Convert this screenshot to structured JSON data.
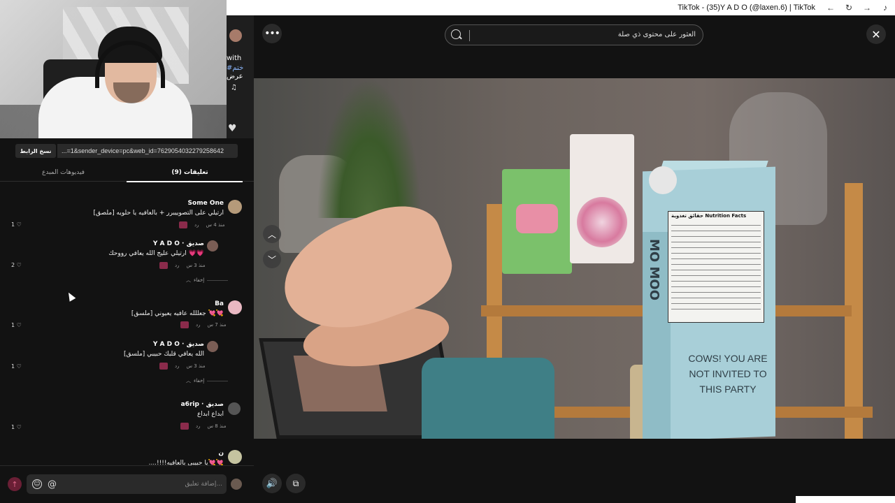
{
  "window": {
    "title": "TikTok - (35)Y A D O (@laxen.6) | TikTok"
  },
  "side_strip": {
    "text1": "with",
    "text2": "#ختم",
    "text3": "عرض"
  },
  "link_bar": {
    "copy_label": "نسخ الرابط",
    "url": "...=1&sender_device=pc&web_id=7629054032279258642"
  },
  "tabs": {
    "creator_videos": "فيديوهات المبدع",
    "comments": "(9) تعليقات"
  },
  "comments": [
    {
      "name": "Some One",
      "text": "[ملصق] ارتيلي على التصوييبرر + بالعافيه يا حلويه",
      "time": "منذ 4 س",
      "reply": "رد",
      "likes": "1"
    },
    {
      "name": "Y A D O · صديق",
      "text": "ارتيلي عليج الله يعافي رووحك 💗💗",
      "time": "منذ 3 س",
      "reply": "رد",
      "likes": "2",
      "hide": "إخفاء"
    },
    {
      "name": "Ba",
      "text": "[ملسق] جعللله عافيه يعيوني 💘💘",
      "time": "منذ 7 س",
      "reply": "رد",
      "likes": "1"
    },
    {
      "name": "Y A D O · صديق",
      "text": "[ملسق] الله يعافي قلبك حبيبي",
      "time": "منذ 3 س",
      "reply": "رد",
      "likes": "1",
      "hide": "إخفاء"
    },
    {
      "name": "a6rip · صديق",
      "text": "ابداع ابداع",
      "time": "منذ 8 س",
      "reply": "رد",
      "likes": "1"
    },
    {
      "name": "ن",
      "text": "....!!!!يا حبيبي بالعافيه💘💘",
      "time": "",
      "reply": "",
      "likes": ""
    }
  ],
  "composer": {
    "placeholder": "إضافة تعليق...",
    "emoji_icon": "☺",
    "mention_icon": "@",
    "send_icon": "↑"
  },
  "viewer": {
    "more_icon": "•••",
    "search_placeholder": "العثور على محتوى ذي صلة",
    "close_icon": "✕",
    "up_icon": "︿",
    "down_icon": "﹀",
    "volume_icon": "🔊",
    "pip_icon": "⧉"
  },
  "video": {
    "nutrition_title": "حقائق تغذوية  Nutrition Facts",
    "carton_brand": "MO MOO",
    "carton_text": "COWS! YOU ARE NOT INVITED TO THIS PARTY"
  }
}
